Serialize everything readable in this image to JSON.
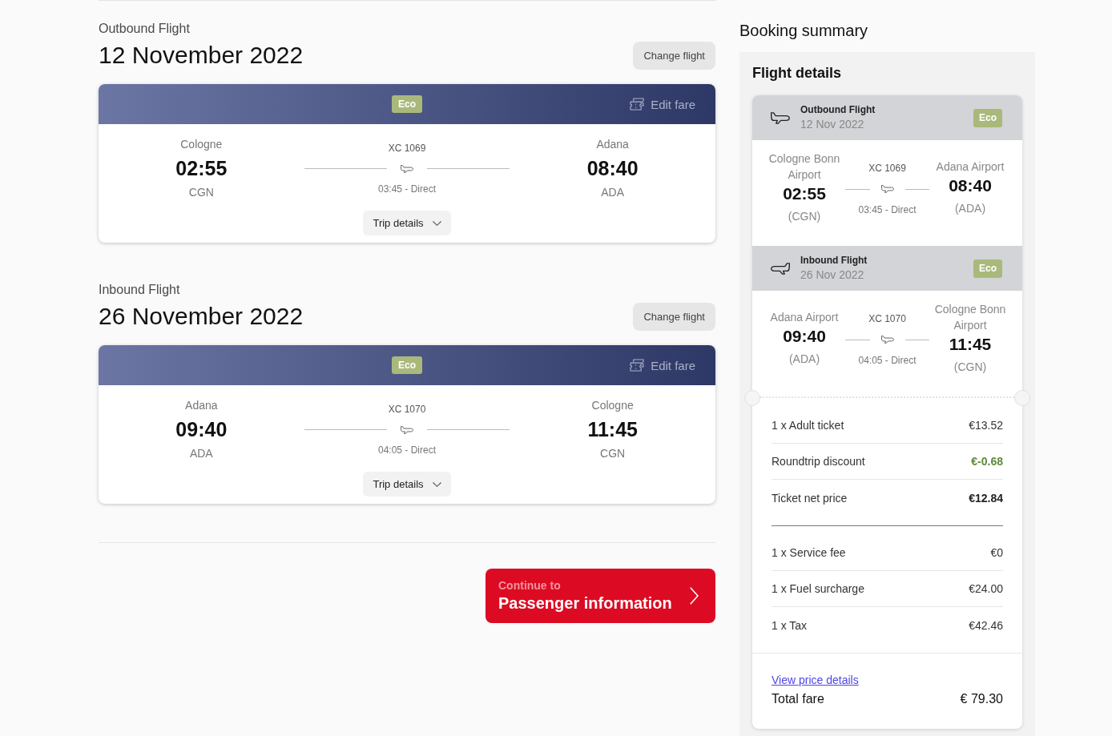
{
  "flights": [
    {
      "heading": "Outbound Flight",
      "date": "12 November 2022",
      "change_button": "Change flight",
      "fare": "Eco",
      "edit_fare": "Edit fare",
      "departure": {
        "city": "Cologne",
        "time": "02:55",
        "code": "CGN"
      },
      "flight_number": "XC 1069",
      "duration": "03:45 - Direct",
      "arrival": {
        "city": "Adana",
        "time": "08:40",
        "code": "ADA"
      },
      "trip_details": "Trip details"
    },
    {
      "heading": "Inbound Flight",
      "date": "26 November 2022",
      "change_button": "Change flight",
      "fare": "Eco",
      "edit_fare": "Edit fare",
      "departure": {
        "city": "Adana",
        "time": "09:40",
        "code": "ADA"
      },
      "flight_number": "XC 1070",
      "duration": "04:05 - Direct",
      "arrival": {
        "city": "Cologne",
        "time": "11:45",
        "code": "CGN"
      },
      "trip_details": "Trip details"
    }
  ],
  "continue_button": {
    "caption": "Continue to",
    "label": "Passenger information"
  },
  "booking_summary": {
    "title": "Booking summary",
    "section_title": "Flight details",
    "flights": [
      {
        "kind": "outbound",
        "heading": "Outbound Flight",
        "date": "12 Nov 2022",
        "fare": "Eco",
        "departure": {
          "airport": "Cologne Bonn Airport",
          "time": "02:55",
          "code": "(CGN)"
        },
        "flight_number": "XC 1069",
        "duration": "03:45 - Direct",
        "arrival": {
          "airport": "Adana Airport",
          "time": "08:40",
          "code": "(ADA)"
        }
      },
      {
        "kind": "inbound",
        "heading": "Inbound Flight",
        "date": "26 Nov 2022",
        "fare": "Eco",
        "departure": {
          "airport": "Adana Airport",
          "time": "09:40",
          "code": "(ADA)"
        },
        "flight_number": "XC 1070",
        "duration": "04:05 - Direct",
        "arrival": {
          "airport": "Cologne Bonn Airport",
          "time": "11:45",
          "code": "(CGN)"
        }
      }
    ],
    "ticket_prices": [
      {
        "kind": "item",
        "label": "1 x Adult ticket",
        "amount": "€13.52"
      },
      {
        "kind": "discount",
        "label": "Roundtrip discount",
        "amount": "€-0.68"
      },
      {
        "kind": "subtotal",
        "label": "Ticket net price",
        "amount": "€12.84"
      }
    ],
    "fees": [
      {
        "kind": "item",
        "label": "1 x Service fee",
        "amount": "€0"
      },
      {
        "kind": "item",
        "label": "1 x Fuel surcharge",
        "amount": "€24.00"
      },
      {
        "kind": "item",
        "label": "1 x Tax",
        "amount": "€42.46"
      }
    ],
    "price_details_link": "View price details",
    "total": {
      "label": "Total fare",
      "amount": "€ 79.30"
    }
  }
}
